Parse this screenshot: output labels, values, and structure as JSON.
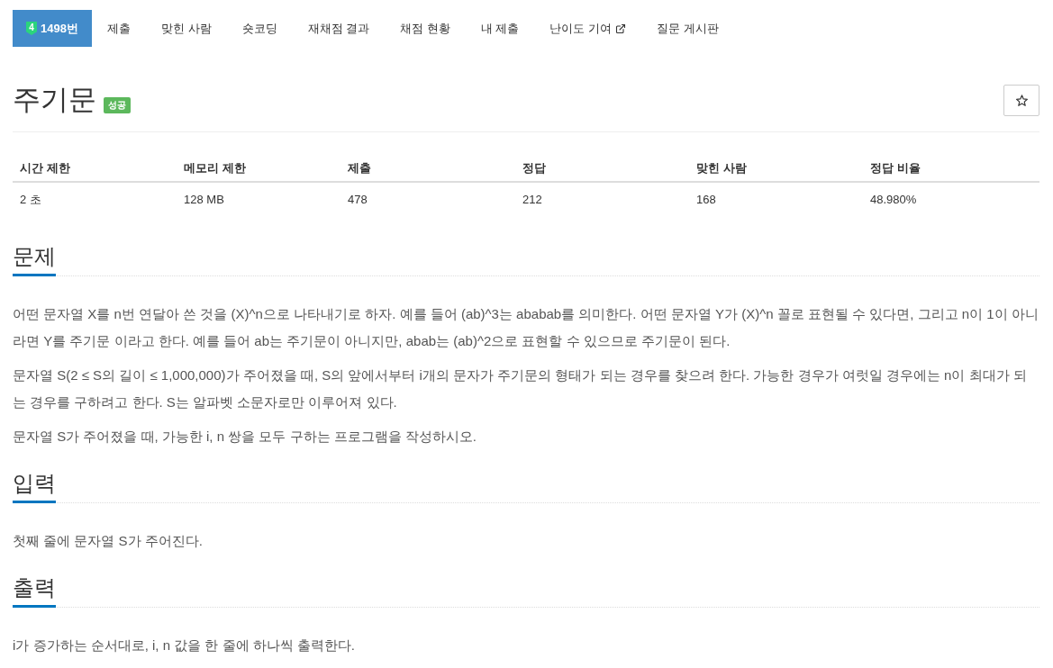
{
  "nav": {
    "tabs": [
      {
        "label": "1498번",
        "selected": true,
        "tier": "4"
      },
      {
        "label": "제출",
        "selected": false
      },
      {
        "label": "맞힌 사람",
        "selected": false
      },
      {
        "label": "숏코딩",
        "selected": false
      },
      {
        "label": "재채점 결과",
        "selected": false
      },
      {
        "label": "채점 현황",
        "selected": false
      },
      {
        "label": "내 제출",
        "selected": false
      },
      {
        "label": "난이도 기여",
        "selected": false,
        "external": true
      },
      {
        "label": "질문 게시판",
        "selected": false
      }
    ]
  },
  "problem": {
    "title": "주기문",
    "result_label": "성공",
    "starred": false
  },
  "stats": {
    "columns": [
      "시간 제한",
      "메모리 제한",
      "제출",
      "정답",
      "맞힌 사람",
      "정답 비율"
    ],
    "row": [
      "2 초",
      "128 MB",
      "478",
      "212",
      "168",
      "48.980%"
    ]
  },
  "sections": [
    {
      "heading": "문제",
      "paragraphs": [
        "어떤 문자열 X를 n번 연달아 쓴 것을 (X)^n으로 나타내기로 하자. 예를 들어 (ab)^3는 ababab를 의미한다. 어떤 문자열 Y가 (X)^n 꼴로 표현될 수 있다면, 그리고 n이 1이 아니라면 Y를 주기문 이라고 한다. 예를 들어 ab는 주기문이 아니지만, abab는 (ab)^2으로 표현할 수 있으므로 주기문이 된다.",
        "문자열 S(2 ≤ S의 길이 ≤ 1,000,000)가 주어졌을 때, S의 앞에서부터 i개의 문자가 주기문의 형태가 되는 경우를 찾으려 한다. 가능한 경우가 여럿일 경우에는 n이 최대가 되는 경우를 구하려고 한다. S는 알파벳 소문자로만 이루어져 있다.",
        "문자열 S가 주어졌을 때, 가능한 i, n 쌍을 모두 구하는 프로그램을 작성하시오."
      ]
    },
    {
      "heading": "입력",
      "paragraphs": [
        "첫째 줄에 문자열 S가 주어진다."
      ]
    },
    {
      "heading": "출력",
      "paragraphs": [
        "i가 증가하는 순서대로, i, n 값을 한 줄에 하나씩 출력한다."
      ]
    }
  ]
}
